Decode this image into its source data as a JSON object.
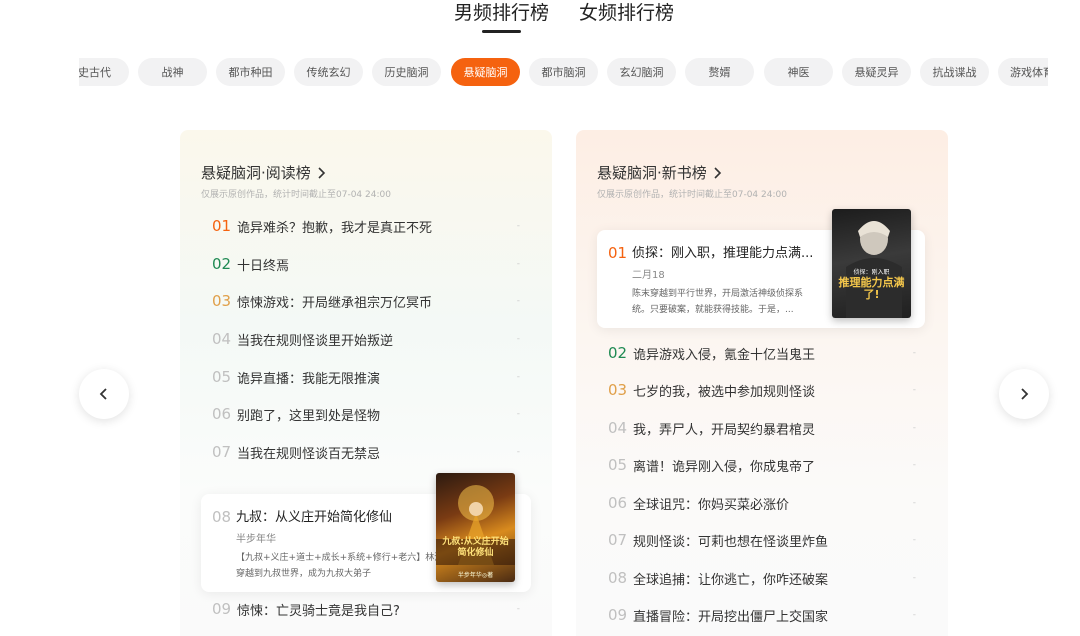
{
  "top_tabs": {
    "male": "男频排行榜",
    "female": "女频排行榜"
  },
  "categories": [
    "历史古代",
    "战神",
    "都市种田",
    "传统玄幻",
    "历史脑洞",
    "悬疑脑洞",
    "都市脑洞",
    "玄幻脑洞",
    "赘婿",
    "神医",
    "悬疑灵异",
    "抗战谍战",
    "游戏体育"
  ],
  "active_category": "悬疑脑洞",
  "left_panel": {
    "title": "悬疑脑洞·阅读榜",
    "subtitle": "仅展示原创作品，统计时间截止至07-04 24:00",
    "items": [
      {
        "rank": "01",
        "title": "诡异难杀？抱歉，我才是真正不死",
        "dash": "-"
      },
      {
        "rank": "02",
        "title": "十日终焉",
        "dash": "-"
      },
      {
        "rank": "03",
        "title": "惊悚游戏：开局继承祖宗万亿冥币",
        "dash": "-"
      },
      {
        "rank": "04",
        "title": "当我在规则怪谈里开始叛逆",
        "dash": "-"
      },
      {
        "rank": "05",
        "title": "诡异直播：我能无限推演",
        "dash": "-"
      },
      {
        "rank": "06",
        "title": "别跑了，这里到处是怪物",
        "dash": "-"
      },
      {
        "rank": "07",
        "title": "当我在规则怪谈百无禁忌",
        "dash": "-"
      }
    ],
    "featured": {
      "rank": "08",
      "title": "九叔：从义庄开始简化修仙",
      "author": "半步年华",
      "desc": "【九叔+义庄+道士+成长+系统+修行+老六】林浩穿越到九叔世界，成为九叔大弟子",
      "cover_text": "九叔:从义庄开始简化修仙",
      "cover_author": "半步年华◎著"
    },
    "after": [
      {
        "rank": "09",
        "title": "惊悚：亡灵骑士竟是我自己?",
        "dash": "-"
      }
    ]
  },
  "right_panel": {
    "title": "悬疑脑洞·新书榜",
    "subtitle": "仅展示原创作品，统计时间截止至07-04 24:00",
    "featured": {
      "rank": "01",
      "title": "侦探：刚入职，推理能力点满...",
      "author": "二月18",
      "desc": "陈末穿越到平行世界，开局激活神级侦探系统。只要破案，就能获得技能。于是，...",
      "cover_text": "推理能力点满了!",
      "cover_top": "侦探：刚入职"
    },
    "items": [
      {
        "rank": "02",
        "title": "诡异游戏入侵，氪金十亿当鬼王",
        "dash": "-"
      },
      {
        "rank": "03",
        "title": "七岁的我，被选中参加规则怪谈",
        "dash": "-"
      },
      {
        "rank": "04",
        "title": "我，弄尸人，开局契约暴君棺灵",
        "dash": "-"
      },
      {
        "rank": "05",
        "title": "离谱！诡异刚入侵，你成鬼帝了",
        "dash": "-"
      },
      {
        "rank": "06",
        "title": "全球诅咒：你妈买菜必涨价",
        "dash": "-"
      },
      {
        "rank": "07",
        "title": "规则怪谈：可莉也想在怪谈里炸鱼",
        "dash": "-"
      },
      {
        "rank": "08",
        "title": "全球追捕：让你逃亡，你咋还破案",
        "dash": "-"
      },
      {
        "rank": "09",
        "title": "直播冒险：开局挖出僵尸上交国家",
        "dash": "-"
      }
    ]
  },
  "icons": {
    "prev": "chevron-left-icon",
    "next": "chevron-right-icon",
    "title_arrow": "chevron-right-icon"
  },
  "colors": {
    "accent": "#f5620f",
    "rank2": "#1f8a53",
    "rank3": "#e0a04a"
  }
}
